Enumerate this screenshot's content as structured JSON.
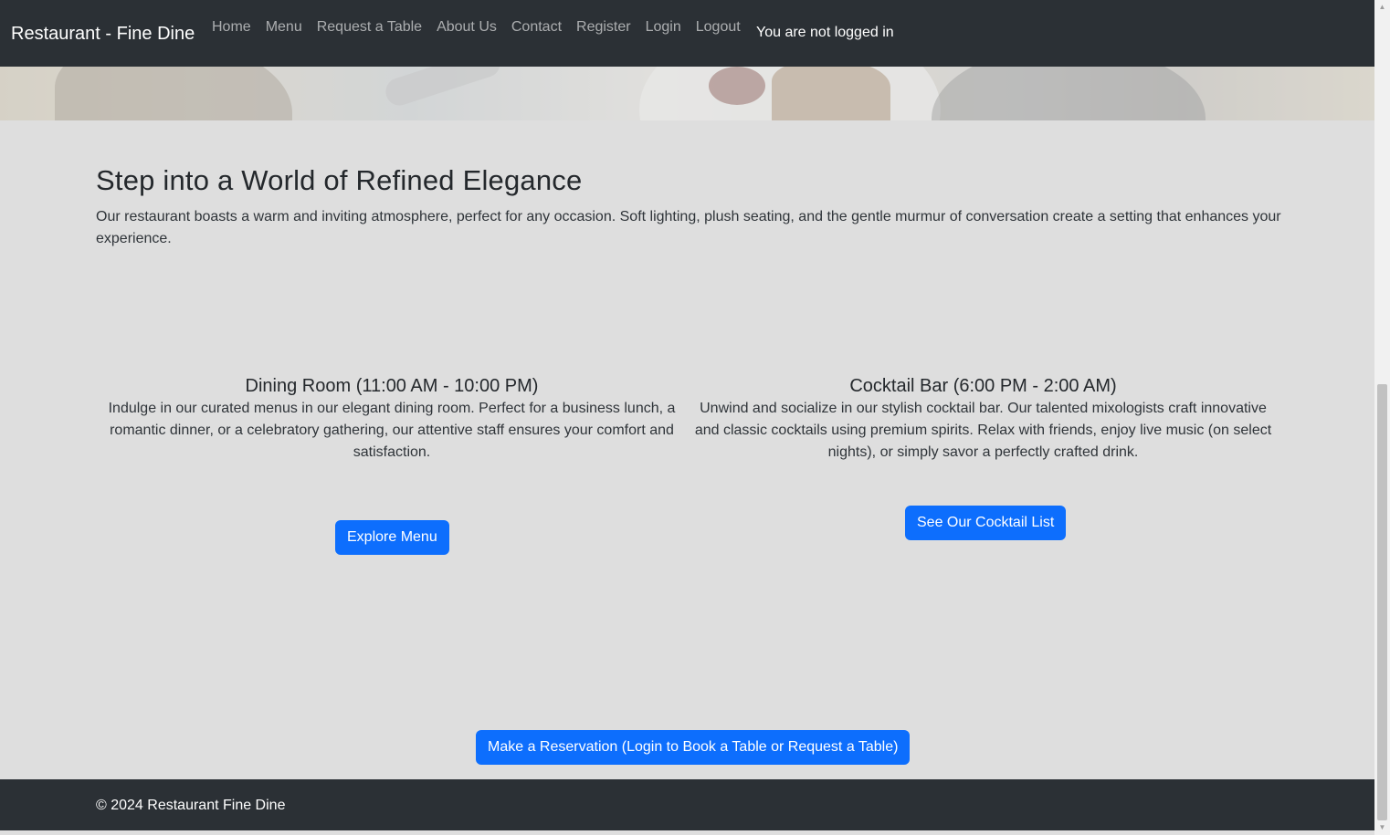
{
  "navbar": {
    "brand": "Restaurant - Fine Dine",
    "links": [
      "Home",
      "Menu",
      "Request a Table",
      "About Us",
      "Contact",
      "Register",
      "Login",
      "Logout"
    ],
    "status": "You are not logged in"
  },
  "intro": {
    "heading": "Step into a World of Refined Elegance",
    "text": "Our restaurant boasts a warm and inviting atmosphere, perfect for any occasion. Soft lighting, plush seating, and the gentle murmur of conversation create a setting that enhances your experience."
  },
  "dining": {
    "title": "Dining Room (11:00 AM - 10:00 PM)",
    "text": "Indulge in our curated menus in our elegant dining room. Perfect for a business lunch, a romantic dinner, or a celebratory gathering, our attentive staff ensures your comfort and satisfaction.",
    "button": "Explore Menu"
  },
  "bar": {
    "title": "Cocktail Bar (6:00 PM - 2:00 AM)",
    "text": "Unwind and socialize in our stylish cocktail bar. Our talented mixologists craft innovative and classic cocktails using premium spirits. Relax with friends, enjoy live music (on select nights), or simply savor a perfectly crafted drink.",
    "button": "See Our Cocktail List"
  },
  "reservation": {
    "button": "Make a Reservation (Login to Book a Table or Request a Table)"
  },
  "footer": {
    "text": "© 2024 Restaurant Fine Dine"
  },
  "colors": {
    "navbar_bg": "#2b3035",
    "primary": "#0d6efd",
    "page_bg": "#dedede"
  }
}
